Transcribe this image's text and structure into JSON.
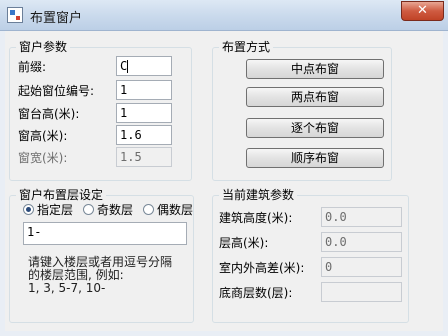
{
  "window": {
    "title": "布置窗户",
    "close_glyph": "✕"
  },
  "window_params": {
    "legend": "窗户参数",
    "fields": [
      {
        "label": "前缀:",
        "value": "C",
        "focused": true,
        "enabled": true
      },
      {
        "label": "起始窗位编号:",
        "value": "1",
        "enabled": true
      },
      {
        "label": "窗台高(米):",
        "value": "1",
        "enabled": true
      },
      {
        "label": "窗高(米):",
        "value": "1.6",
        "enabled": true
      },
      {
        "label": "窗宽(米):",
        "value": "1.5",
        "enabled": false
      }
    ]
  },
  "layout_mode": {
    "legend": "布置方式",
    "buttons": [
      "中点布窗",
      "两点布窗",
      "逐个布窗",
      "顺序布窗"
    ]
  },
  "floor_setting": {
    "legend": "窗户布置层设定",
    "options": [
      {
        "label": "指定层",
        "selected": true
      },
      {
        "label": "奇数层",
        "selected": false
      },
      {
        "label": "偶数层",
        "selected": false
      }
    ],
    "floor_input": "1-",
    "hint_lines": [
      "请键入楼层或者用逗号分隔",
      "的楼层范围, 例如:",
      "1, 3, 5-7, 10-"
    ]
  },
  "building_params": {
    "legend": "当前建筑参数",
    "rows": [
      {
        "label": "建筑高度(米):",
        "value": "0.0"
      },
      {
        "label": "层高(米):",
        "value": "0.0"
      },
      {
        "label": "室内外高差(米):",
        "value": "0"
      },
      {
        "label": "底商层数(层):",
        "value": ""
      }
    ]
  }
}
